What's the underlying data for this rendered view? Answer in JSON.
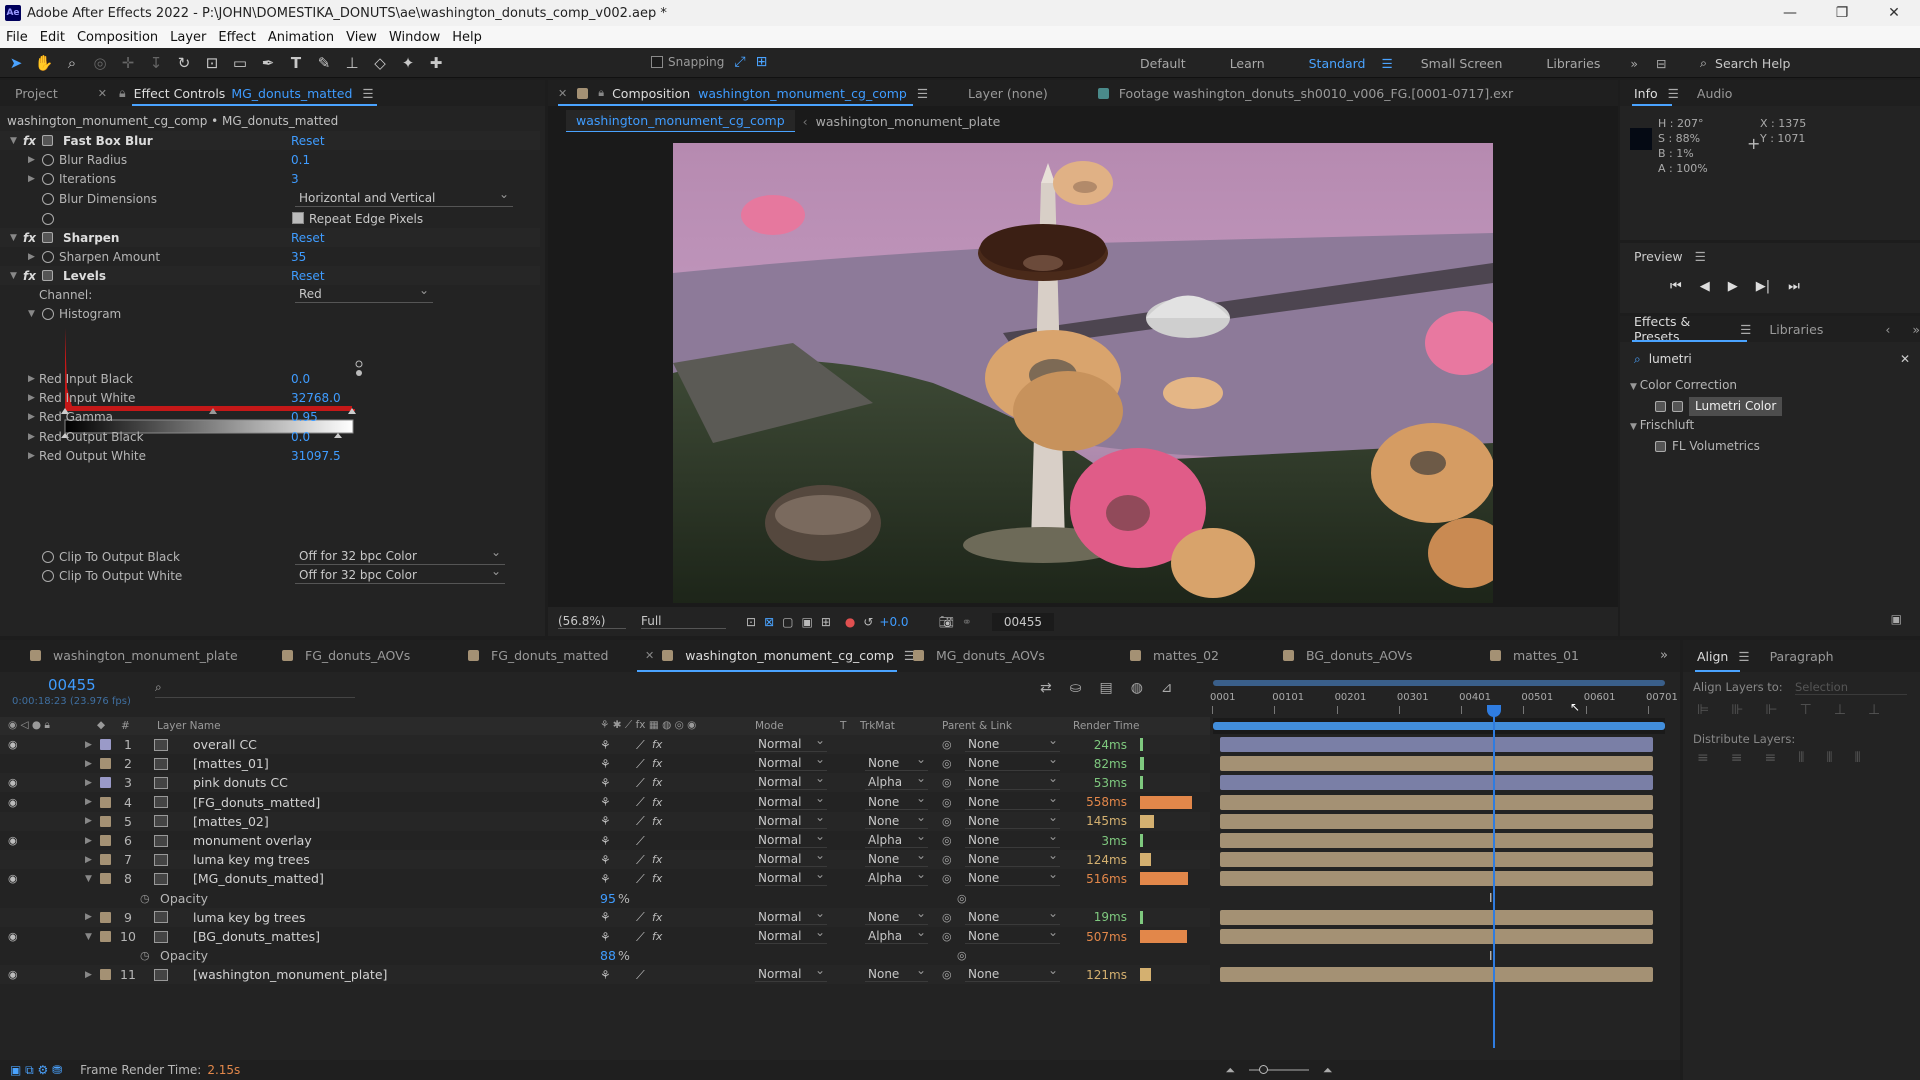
{
  "window": {
    "app_icon": "Ae",
    "title": "Adobe After Effects 2022 - P:\\JOHN\\DOMESTIKA_DONUTS\\ae\\washington_donuts_comp_v002.aep *",
    "minimize": "—",
    "maximize": "❐",
    "close": "✕"
  },
  "menu": [
    "File",
    "Edit",
    "Composition",
    "Layer",
    "Effect",
    "Animation",
    "View",
    "Window",
    "Help"
  ],
  "toolbar": {
    "snapping": "Snapping",
    "workspaces": [
      "Default",
      "Learn",
      "Standard",
      "Small Screen",
      "Libraries"
    ],
    "active_workspace": "Standard",
    "search_help": "Search Help",
    "more": "»"
  },
  "effect_controls": {
    "tab_project": "Project",
    "tab_label": "Effect Controls",
    "tab_layer": "MG_donuts_matted",
    "breadcrumb": "washington_monument_cg_comp • MG_donuts_matted",
    "fast_box_blur": {
      "name": "Fast Box Blur",
      "reset": "Reset",
      "blur_radius_label": "Blur Radius",
      "blur_radius": "0.1",
      "iterations_label": "Iterations",
      "iterations": "3",
      "blur_dimensions_label": "Blur Dimensions",
      "blur_dimensions": "Horizontal and Vertical",
      "repeat_edge_label": "Repeat Edge Pixels"
    },
    "sharpen": {
      "name": "Sharpen",
      "reset": "Reset",
      "amount_label": "Sharpen Amount",
      "amount": "35"
    },
    "levels": {
      "name": "Levels",
      "reset": "Reset",
      "channel_label": "Channel:",
      "channel": "Red",
      "histogram_label": "Histogram",
      "params": [
        {
          "label": "Red Input Black",
          "value": "0.0"
        },
        {
          "label": "Red Input White",
          "value": "32768.0"
        },
        {
          "label": "Red Gamma",
          "value": "0.95"
        },
        {
          "label": "Red Output Black",
          "value": "0.0"
        },
        {
          "label": "Red Output White",
          "value": "31097.5"
        }
      ],
      "clip_black_label": "Clip To Output Black",
      "clip_black": "Off for 32 bpc Color",
      "clip_white_label": "Clip To Output White",
      "clip_white": "Off for 32 bpc Color"
    }
  },
  "composition": {
    "tab_label": "Composition",
    "comp_name": "washington_monument_cg_comp",
    "layer_tab": "Layer  (none)",
    "footage_tab": "Footage  washington_donuts_sh0010_v006_FG.[0001-0717].exr",
    "flow_active": "washington_monument_cg_comp",
    "flow_other": "washington_monument_plate",
    "zoom": "(56.8%)",
    "resolution": "Full",
    "exposure": "+0.0",
    "timecode": "00455"
  },
  "info": {
    "tab": "Info",
    "audio_tab": "Audio",
    "h": "H : 207°",
    "s": "S :  88%",
    "b": "B :   1%",
    "a": "A :  100%",
    "x": "X : 1375",
    "y": "Y : 1071"
  },
  "preview": {
    "title": "Preview"
  },
  "effects_presets": {
    "tab": "Effects & Presets",
    "libraries_tab": "Libraries",
    "search": "lumetri",
    "groups": [
      {
        "name": "Color Correction",
        "items": [
          "Lumetri Color"
        ]
      },
      {
        "name": "Frischluft",
        "items": [
          "FL Volumetrics"
        ]
      }
    ]
  },
  "align": {
    "tab": "Align",
    "paragraph_tab": "Paragraph",
    "align_layers_to": "Align Layers to:",
    "selection": "Selection",
    "distribute": "Distribute Layers:"
  },
  "timeline": {
    "tabs": [
      "washington_monument_plate",
      "FG_donuts_AOVs",
      "FG_donuts_matted",
      "washington_monument_cg_comp",
      "MG_donuts_AOVs",
      "mattes_02",
      "BG_donuts_AOVs",
      "mattes_01"
    ],
    "active_tab": "washington_monument_cg_comp",
    "current_time": "00455",
    "timecode_sub": "0:00:18:23 (23.976 fps)",
    "columns": {
      "num": "#",
      "layer_name": "Layer Name",
      "mode": "Mode",
      "t": "T",
      "trkmat": "TrkMat",
      "parent": "Parent & Link",
      "render_time": "Render Time"
    },
    "ruler": [
      "0001",
      "00101",
      "00201",
      "00301",
      "00401",
      "00501",
      "00601",
      "00701"
    ],
    "frame_render_label": "Frame Render Time:",
    "frame_render_value": "2.15s",
    "layers": [
      {
        "num": "1",
        "name": "overall CC",
        "color": "#9a9ac8",
        "mode": "Normal",
        "trkmat": "",
        "parent": "None",
        "rt": "24ms",
        "rt_frac": 0.02,
        "eye": true,
        "fx": true
      },
      {
        "num": "2",
        "name": "[mattes_01]",
        "color": "#a49174",
        "mode": "Normal",
        "trkmat": "None",
        "parent": "None",
        "rt": "82ms",
        "rt_frac": 0.07,
        "eye": false,
        "fx": true
      },
      {
        "num": "3",
        "name": "pink donuts CC",
        "color": "#9a9ac8",
        "mode": "Normal",
        "trkmat": "Alpha",
        "parent": "None",
        "rt": "53ms",
        "rt_frac": 0.05,
        "eye": true,
        "fx": true
      },
      {
        "num": "4",
        "name": "[FG_donuts_matted]",
        "color": "#a49174",
        "mode": "Normal",
        "trkmat": "None",
        "parent": "None",
        "rt": "558ms",
        "rt_frac": 1.0,
        "eye": true,
        "fx": true
      },
      {
        "num": "5",
        "name": "[mattes_02]",
        "color": "#a49174",
        "mode": "Normal",
        "trkmat": "None",
        "parent": "None",
        "rt": "145ms",
        "rt_frac": 0.26,
        "eye": false,
        "fx": true
      },
      {
        "num": "6",
        "name": "monument overlay",
        "color": "#a49174",
        "mode": "Normal",
        "trkmat": "Alpha",
        "parent": "None",
        "rt": "3ms",
        "rt_frac": 0.01,
        "eye": true,
        "fx": false
      },
      {
        "num": "7",
        "name": "luma key mg trees",
        "color": "#a49174",
        "mode": "Normal",
        "trkmat": "None",
        "parent": "None",
        "rt": "124ms",
        "rt_frac": 0.22,
        "eye": false,
        "fx": true
      },
      {
        "num": "8",
        "name": "[MG_donuts_matted]",
        "color": "#a49174",
        "mode": "Normal",
        "trkmat": "Alpha",
        "parent": "None",
        "rt": "516ms",
        "rt_frac": 0.92,
        "eye": true,
        "fx": true,
        "opacity": "95"
      },
      {
        "num": "9",
        "name": "luma key bg trees",
        "color": "#a49174",
        "mode": "Normal",
        "trkmat": "None",
        "parent": "None",
        "rt": "19ms",
        "rt_frac": 0.02,
        "eye": false,
        "fx": true
      },
      {
        "num": "10",
        "name": "[BG_donuts_mattes]",
        "color": "#a49174",
        "mode": "Normal",
        "trkmat": "Alpha",
        "parent": "None",
        "rt": "507ms",
        "rt_frac": 0.91,
        "eye": true,
        "fx": true,
        "opacity": "88"
      },
      {
        "num": "11",
        "name": "[washington_monument_plate]",
        "color": "#a49174",
        "mode": "Normal",
        "trkmat": "None",
        "parent": "None",
        "rt": "121ms",
        "rt_frac": 0.22,
        "eye": true,
        "fx": false
      }
    ],
    "opacity_label": "Opacity",
    "percent": "%"
  }
}
